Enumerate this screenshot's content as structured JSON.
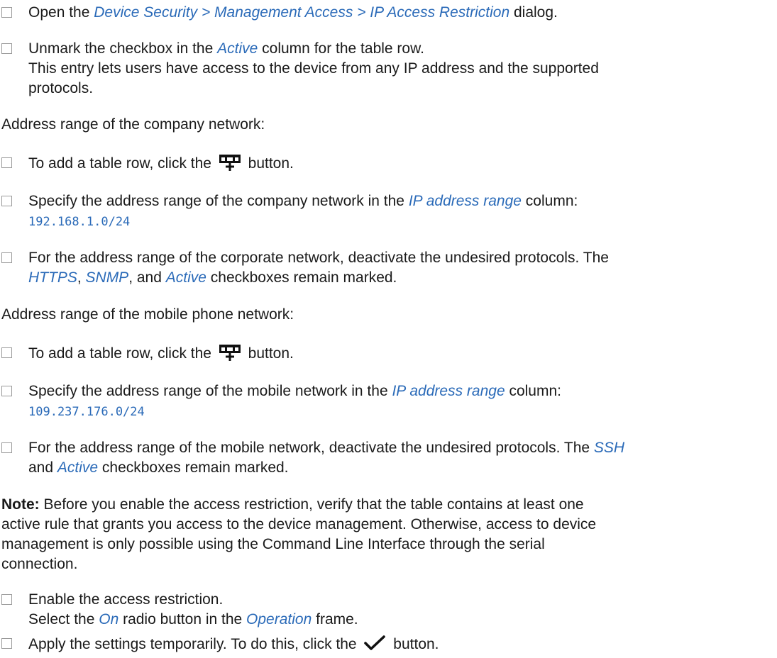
{
  "steps": {
    "s1": {
      "pre": "Open the ",
      "kw": "Device Security > Management Access > IP Access Restriction",
      "post": " dialog."
    },
    "s2": {
      "pre": "Unmark the checkbox in the ",
      "kw": "Active",
      "post": " column for the table row.",
      "line2": "This entry lets users have access to the device from any IP address and the supported",
      "line3": "protocols."
    },
    "company_heading": "Address range of the company network:",
    "s3": {
      "pre": "To add a table row, click the ",
      "post": " button.",
      "icon": "add-table-row-icon"
    },
    "s4": {
      "pre": "Specify the address range of the company network in the ",
      "kw": "IP address range",
      "post": " column:",
      "code": "192.168.1.0/24"
    },
    "s5": {
      "line1": "For the address range of the corporate network, deactivate the undesired protocols. The",
      "kw1": "HTTPS",
      "sep1": ", ",
      "kw2": "SNMP",
      "sep2": ", and ",
      "kw3": "Active",
      "post": " checkboxes remain marked."
    },
    "mobile_heading": "Address range of the mobile phone network:",
    "s6": {
      "pre": "To add a table row, click the ",
      "post": " button.",
      "icon": "add-table-row-icon"
    },
    "s7": {
      "pre": "Specify the address range of the mobile network in the ",
      "kw": "IP address range",
      "post": " column:",
      "code": "109.237.176.0/24"
    },
    "s8": {
      "pre": "For the address range of the mobile network, deactivate the undesired protocols. The ",
      "kw1": "SSH",
      "and": "and ",
      "kw2": "Active",
      "post": " checkboxes remain marked."
    },
    "note": {
      "label": "Note:",
      "line1": " Before you enable the access restriction, verify that the table contains at least one",
      "line2": "active rule that grants you access to the device management. Otherwise, access to device",
      "line3": "management is only possible using the Command Line Interface through the serial",
      "line4": "connection."
    },
    "s9": {
      "line1": "Enable the access restriction.",
      "pre": "Select the ",
      "kw1": "On",
      "mid": " radio button in the ",
      "kw2": "Operation",
      "post": " frame."
    },
    "s10": {
      "pre": "Apply the settings temporarily. To do this, click the ",
      "post": " button.",
      "icon": "checkmark-icon"
    }
  },
  "colors": {
    "keyword": "#2a6ab8",
    "checkbox_border": "#9a9a9a"
  }
}
